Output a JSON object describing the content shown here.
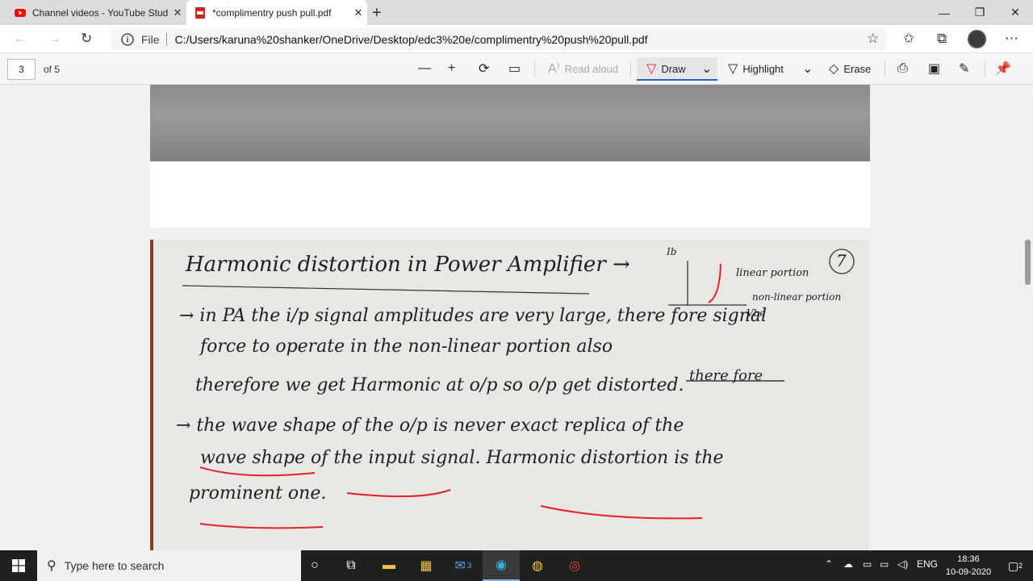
{
  "tabs": [
    {
      "title": "Channel videos - YouTube Studio",
      "favicon": "youtube-icon"
    },
    {
      "title": "*complimentry push pull.pdf",
      "favicon": "pdf-icon"
    }
  ],
  "address_bar": {
    "scheme_label": "File",
    "url": "C:/Users/karuna%20shanker/OneDrive/Desktop/edc3%20e/complimentry%20push%20pull.pdf"
  },
  "pdf_toolbar": {
    "page_number": "3",
    "page_count": "of 5",
    "read_aloud": "Read aloud",
    "draw": "Draw",
    "highlight": "Highlight",
    "erase": "Erase"
  },
  "document": {
    "lines": [
      "Harmonic distortion in Power Amplifier →",
      "→ in PA the i/p signal amplitudes are very large, there fore signal",
      "force to operate in the non-linear portion also",
      "therefore we get Harmonic at o/p so o/p get distorted.",
      "→ the wave shape of the o/p is never exact replica of the",
      "wave shape of the input signal. Harmonic distortion is the",
      "prominent one."
    ],
    "struck_word": "there fore",
    "page_mark": "7",
    "graph": {
      "y_label": "Ib",
      "x_label": "Vbe",
      "label_linear": "linear portion",
      "label_nonlinear": "non-linear portion"
    }
  },
  "taskbar": {
    "search_placeholder": "Type here to search",
    "mail_badge": "3",
    "language": "ENG",
    "time": "18:36",
    "date": "10-09-2020",
    "notification_badge": "2"
  },
  "colors": {
    "accent": "#2a62c9",
    "youtube": "#ff0000",
    "pen": "#e5202a"
  }
}
